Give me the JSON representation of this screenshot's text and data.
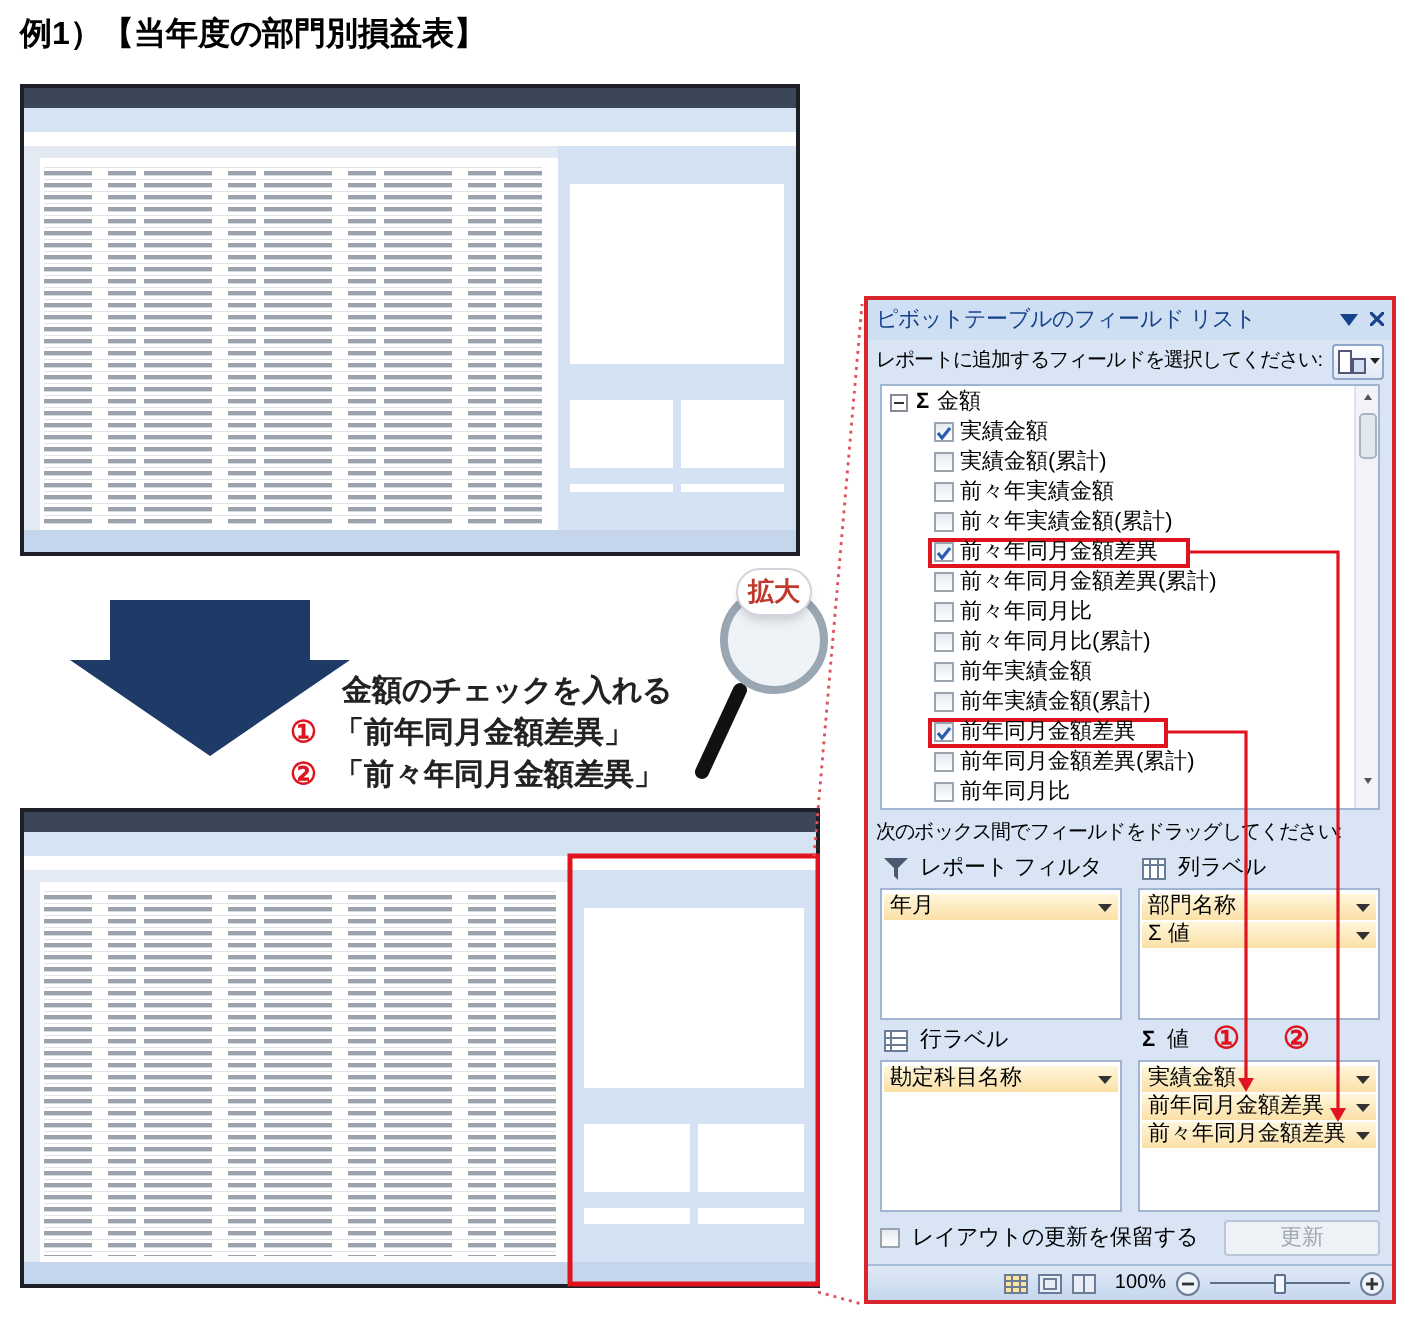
{
  "heading": "例1）【当年度の部門別損益表】",
  "screenshots": [
    {
      "kind": "spreadsheet_window",
      "pane_highlighted": false
    },
    {
      "kind": "spreadsheet_window",
      "pane_highlighted": true
    }
  ],
  "instruction": [
    {
      "text": "金額のチェックを入れる"
    },
    {
      "marker": "①",
      "text": "「前年同月金額差異」"
    },
    {
      "marker": "②",
      "text": "「前々年同月金額差異」"
    }
  ],
  "zoom_callout": "拡大",
  "field_list": {
    "title": "ピボットテーブルのフィールド リスト",
    "prompt": "レポートに追加するフィールドを選択してください:",
    "fields": [
      {
        "symbol": "Σ",
        "label": "金額",
        "expanded": true,
        "children": [
          {
            "label": "実績金額",
            "checked": true,
            "highlighted": false
          },
          {
            "label": "実績金額(累計)",
            "checked": false,
            "highlighted": false
          },
          {
            "label": "前々年実績金額",
            "checked": false,
            "highlighted": false
          },
          {
            "label": "前々年実績金額(累計)",
            "checked": false,
            "highlighted": false
          },
          {
            "label": "前々年同月金額差異",
            "checked": true,
            "highlighted": true
          },
          {
            "label": "前々年同月金額差異(累計)",
            "checked": false,
            "highlighted": false
          },
          {
            "label": "前々年同月比",
            "checked": false,
            "highlighted": false
          },
          {
            "label": "前々年同月比(累計)",
            "checked": false,
            "highlighted": false
          },
          {
            "label": "前年実績金額",
            "checked": false,
            "highlighted": false
          },
          {
            "label": "前年実績金額(累計)",
            "checked": false,
            "highlighted": false
          },
          {
            "label": "前年同月金額差異",
            "checked": true,
            "highlighted": true
          },
          {
            "label": "前年同月金額差異(累計)",
            "checked": false,
            "highlighted": false
          },
          {
            "label": "前年同月比",
            "checked": false,
            "highlighted": false
          }
        ]
      }
    ],
    "drag_prompt": "次のボックス間でフィールドをドラッグしてください:",
    "areas": [
      {
        "kind": "filter",
        "label": "レポート フィルタ",
        "items": [
          {
            "label": "年月"
          }
        ]
      },
      {
        "kind": "columns",
        "label": "列ラベル",
        "items": [
          {
            "label": "部門名称"
          },
          {
            "symbol": "Σ",
            "label": "値"
          }
        ]
      },
      {
        "kind": "rows",
        "label": "行ラベル",
        "items": [
          {
            "label": "勘定科目名称"
          }
        ]
      },
      {
        "kind": "values",
        "symbol": "Σ",
        "label": "値",
        "markers": [
          "①",
          "②"
        ],
        "items": [
          {
            "label": "実績金額"
          },
          {
            "label": "前年同月金額差異"
          },
          {
            "label": "前々年同月金額差異"
          }
        ]
      }
    ],
    "defer_update": {
      "label": "レイアウトの更新を保留する",
      "checked": false
    },
    "update_button": {
      "label": "更新",
      "disabled": true
    },
    "status_bar": {
      "zoom": "100%",
      "zoom_slider": {
        "level": 0.5
      }
    }
  }
}
